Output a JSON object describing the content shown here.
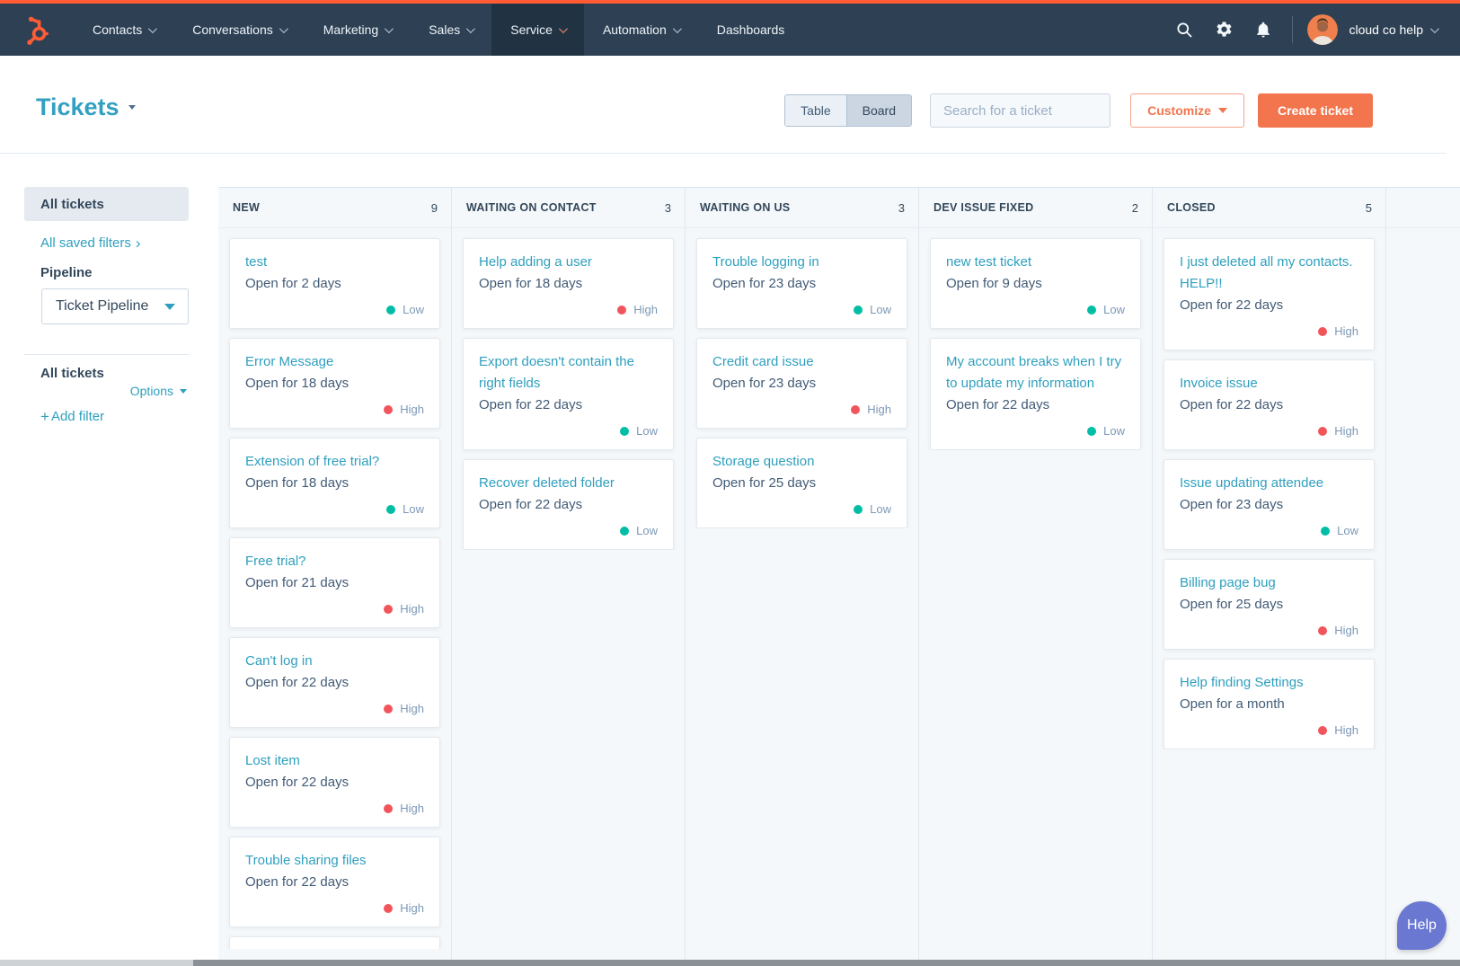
{
  "nav": {
    "items": [
      {
        "label": "Contacts",
        "caret": true,
        "active": false
      },
      {
        "label": "Conversations",
        "caret": true,
        "active": false
      },
      {
        "label": "Marketing",
        "caret": true,
        "active": false
      },
      {
        "label": "Sales",
        "caret": true,
        "active": false
      },
      {
        "label": "Service",
        "caret": true,
        "active": true
      },
      {
        "label": "Automation",
        "caret": true,
        "active": false
      },
      {
        "label": "Dashboards",
        "caret": false,
        "active": false
      }
    ],
    "account_name": "cloud co help"
  },
  "header": {
    "title": "Tickets",
    "view_toggle": {
      "table_label": "Table",
      "board_label": "Board",
      "active": "Board"
    },
    "search_placeholder": "Search for a ticket",
    "customize_label": "Customize",
    "create_ticket_label": "Create ticket"
  },
  "sidebar": {
    "selected_item": "All tickets",
    "saved_filters_link": "All saved filters",
    "pipeline_label": "Pipeline",
    "pipeline_value": "Ticket Pipeline",
    "view_title": "All tickets",
    "options_label": "Options",
    "add_filter_label": "Add filter"
  },
  "board": {
    "columns": [
      {
        "name": "NEW",
        "count": 9,
        "partial_card": true,
        "cards": [
          {
            "title": "test",
            "age": "Open for 2 days",
            "priority": "Low"
          },
          {
            "title": "Error Message",
            "age": "Open for 18 days",
            "priority": "High"
          },
          {
            "title": "Extension of free trial?",
            "age": "Open for 18 days",
            "priority": "Low"
          },
          {
            "title": "Free trial?",
            "age": "Open for 21 days",
            "priority": "High"
          },
          {
            "title": "Can't log in",
            "age": "Open for 22 days",
            "priority": "High"
          },
          {
            "title": "Lost item",
            "age": "Open for 22 days",
            "priority": "High"
          },
          {
            "title": "Trouble sharing files",
            "age": "Open for 22 days",
            "priority": "High"
          }
        ]
      },
      {
        "name": "WAITING ON CONTACT",
        "count": 3,
        "partial_card": false,
        "cards": [
          {
            "title": "Help adding a user",
            "age": "Open for 18 days",
            "priority": "High"
          },
          {
            "title": "Export doesn't contain the right fields",
            "age": "Open for 22 days",
            "priority": "Low"
          },
          {
            "title": "Recover deleted folder",
            "age": "Open for 22 days",
            "priority": "Low"
          }
        ]
      },
      {
        "name": "WAITING ON US",
        "count": 3,
        "partial_card": false,
        "cards": [
          {
            "title": "Trouble logging in",
            "age": "Open for 23 days",
            "priority": "Low"
          },
          {
            "title": "Credit card issue",
            "age": "Open for 23 days",
            "priority": "High"
          },
          {
            "title": "Storage question",
            "age": "Open for 25 days",
            "priority": "Low"
          }
        ]
      },
      {
        "name": "DEV ISSUE FIXED",
        "count": 2,
        "partial_card": false,
        "cards": [
          {
            "title": "new test ticket",
            "age": "Open for 9 days",
            "priority": "Low"
          },
          {
            "title": "My account breaks when I try to update my information",
            "age": "Open for 22 days",
            "priority": "Low"
          }
        ]
      },
      {
        "name": "CLOSED",
        "count": 5,
        "partial_card": false,
        "cards": [
          {
            "title": "I just deleted all my contacts. HELP!!",
            "age": "Open for 22 days",
            "priority": "High"
          },
          {
            "title": "Invoice issue",
            "age": "Open for 22 days",
            "priority": "High"
          },
          {
            "title": "Issue updating attendee",
            "age": "Open for 23 days",
            "priority": "Low"
          },
          {
            "title": "Billing page bug",
            "age": "Open for 25 days",
            "priority": "High"
          },
          {
            "title": "Help finding Settings",
            "age": "Open for a month",
            "priority": "High"
          }
        ]
      }
    ]
  },
  "help_label": "Help",
  "colors": {
    "brand_orange": "#ff5c35",
    "accent_orange": "#f2754e",
    "link_teal": "#2e9fbe",
    "priority": {
      "low": "#00bda5",
      "high": "#f2545b"
    }
  }
}
